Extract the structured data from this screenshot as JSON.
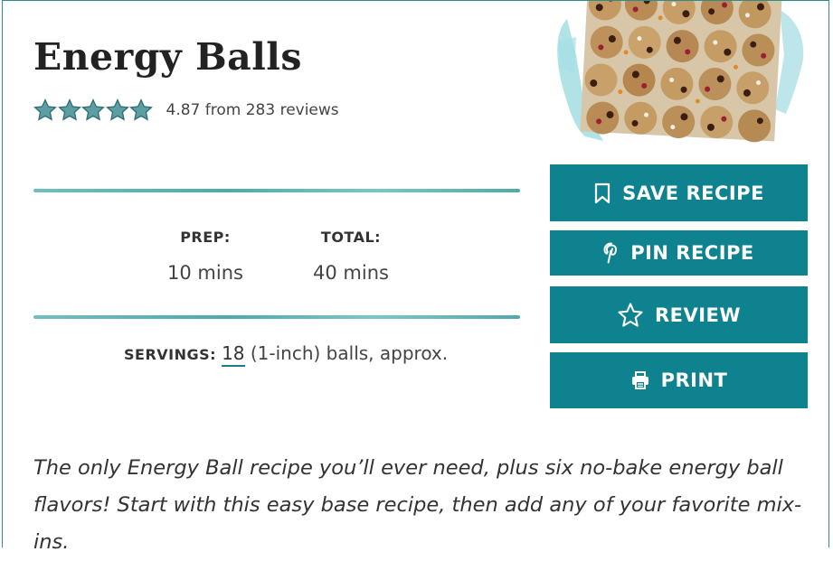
{
  "recipe": {
    "title": "Energy Balls",
    "rating": {
      "stars": 5,
      "value": 4.87,
      "text": "4.87 from 283 reviews"
    },
    "times": {
      "prep": {
        "label": "PREP:",
        "value": "10 mins"
      },
      "total": {
        "label": "TOTAL:",
        "value": "40 mins"
      }
    },
    "servings": {
      "label": "SERVINGS:",
      "count": "18",
      "suffix": "(1-inch) balls, approx."
    },
    "description": "The only Energy Ball recipe you’ll ever need, plus six no-bake energy ball flavors! Start with this easy base recipe, then add any of your favorite mix-ins."
  },
  "actions": {
    "save_label": "SAVE RECIPE",
    "pin_label": "PIN RECIPE",
    "review_label": "REVIEW",
    "print_label": "PRINT"
  },
  "icons": {
    "save": "bookmark-icon",
    "pin": "pinterest-icon",
    "review": "star-outline-icon",
    "print": "printer-icon",
    "rating_star": "star-icon"
  },
  "colors": {
    "accent": "#0f8290",
    "star_fill": "#5c9ea3",
    "border": "#2e8c8c",
    "brush": "#4eb0b1",
    "photo_splash": "#7fd0d6"
  }
}
